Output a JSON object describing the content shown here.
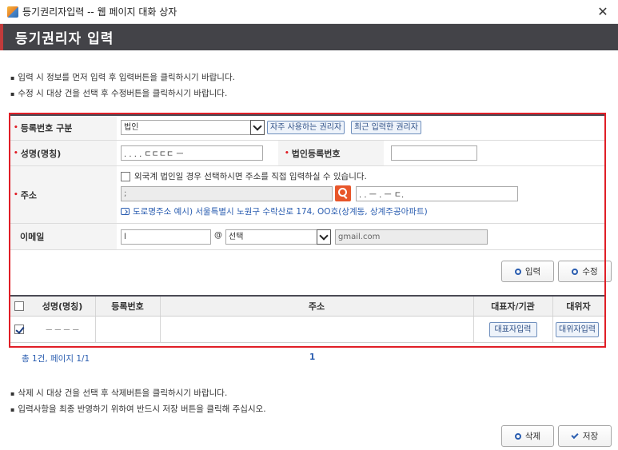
{
  "window": {
    "title": "등기권리자입력 -- 웹 페이지 대화 상자",
    "close_glyph": "✕"
  },
  "header": {
    "title": "등기권리자 입력"
  },
  "notices_top": [
    "입력 시 정보를 먼저 입력 후 입력버튼을 클릭하시기 바랍니다.",
    "수정 시 대상 건을 선택 후 수정버튼을 클릭하시기 바랍니다."
  ],
  "form": {
    "reg_type": {
      "label": "등록번호 구분",
      "selected": "법인",
      "btn_frequent": "자주 사용하는 권리자",
      "btn_recent": "최근 입력한 권리자"
    },
    "name": {
      "label": "성명(명칭)",
      "value": ". . . . ㄷㄷㄷㄷ ㅡ"
    },
    "corp_no": {
      "label": "법인등록번호",
      "value": ""
    },
    "address": {
      "label": "주소",
      "foreign_checkbox_label": "외국계 법인일 경우 선택하시면 주소를 직접 입력하실 수 있습니다.",
      "addr1_value": ";",
      "addr2_value": ". . ㅡ . ㅡ ㄷ.",
      "road_hint": "도로명주소 예시) 서울특별시 노원구 수락산로 174, OO호(상계동, 상계주공아파트)"
    },
    "email": {
      "label": "이메일",
      "local_value": "l",
      "at": "@",
      "domain_selected": "선택",
      "domain_value": "gmail.com"
    }
  },
  "actions": {
    "input": "입력",
    "edit": "수정"
  },
  "grid": {
    "headers": [
      "성명(명칭)",
      "등록번호",
      "주소",
      "대표자/기관",
      "대위자"
    ],
    "rows": [
      {
        "name": "ㅡ ㅡ ㅡ ㅡ",
        "reg_no": "",
        "address": "",
        "rep_button": "대표자입력",
        "proxy_button": "대위자입력"
      }
    ]
  },
  "pager": {
    "summary": "총 1건, 페이지 1/1",
    "page": "1"
  },
  "notices_bottom": [
    "삭제 시 대상 건을 선택 후 삭제버튼을 클릭하시기 바랍니다.",
    "입력사항을 최종 반영하기 위하여 반드시 저장 버튼을 클릭해 주십시오."
  ],
  "footer": {
    "delete": "삭제",
    "save": "저장"
  },
  "colors": {
    "header_bg": "#434348",
    "accent_red": "#e01e26",
    "link_blue": "#2a5db0",
    "search_orange": "#e8562a"
  }
}
